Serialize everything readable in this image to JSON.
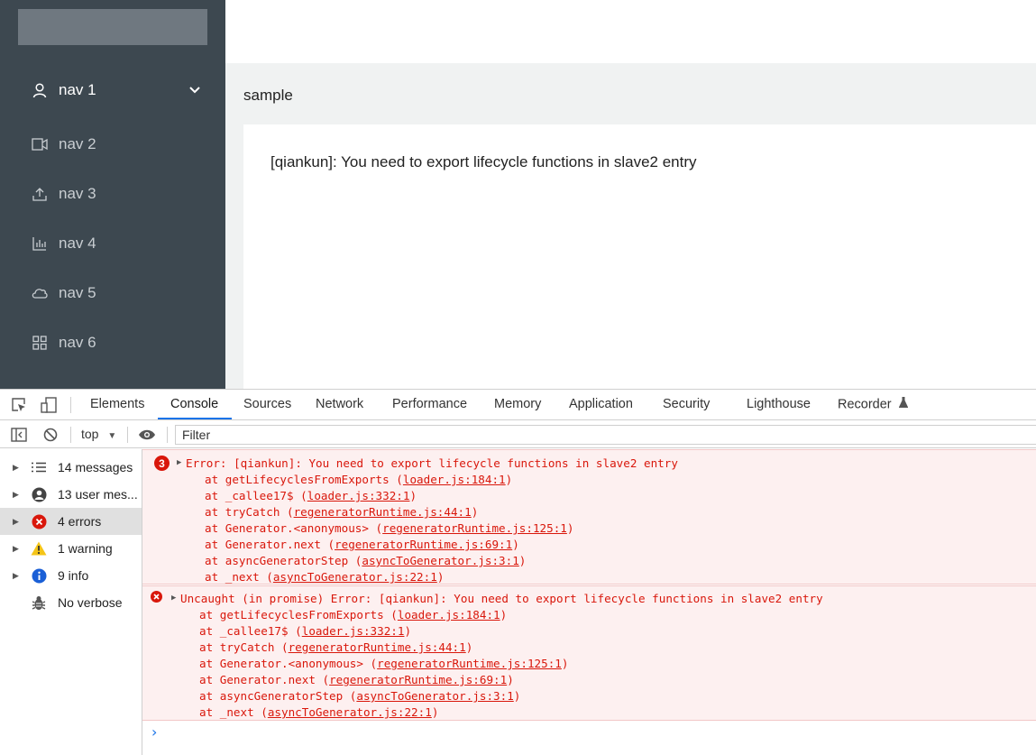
{
  "app": {
    "nav": [
      {
        "label": "nav 1",
        "icon": "user-icon"
      },
      {
        "label": "nav 2",
        "icon": "video-camera-icon"
      },
      {
        "label": "nav 3",
        "icon": "upload-icon"
      },
      {
        "label": "nav 4",
        "icon": "bar-chart-icon"
      },
      {
        "label": "nav 5",
        "icon": "cloud-icon"
      },
      {
        "label": "nav 6",
        "icon": "appstore-icon"
      }
    ],
    "breadcrumb": "sample",
    "message": "[qiankun]: You need to export lifecycle functions in slave2 entry"
  },
  "devtools": {
    "tabs": [
      "Elements",
      "Console",
      "Sources",
      "Network",
      "Performance",
      "Memory",
      "Application",
      "Security",
      "Lighthouse",
      "Recorder"
    ],
    "active_tab": "Console",
    "context": "top",
    "filter_placeholder": "Filter",
    "sidebar": [
      {
        "label": "14 messages",
        "icon": "list-icon"
      },
      {
        "label": "13 user mes...",
        "icon": "user-circle-icon"
      },
      {
        "label": "4 errors",
        "icon": "error-icon"
      },
      {
        "label": "1 warning",
        "icon": "warning-icon"
      },
      {
        "label": "9 info",
        "icon": "info-icon"
      },
      {
        "label": "No verbose",
        "icon": "bug-icon"
      }
    ],
    "errors": [
      {
        "count": "3",
        "message": "Error: [qiankun]: You need to export lifecycle functions in slave2 entry",
        "frames": [
          {
            "prefix": "at getLifecyclesFromExports (",
            "link": "loader.js:184:1",
            "suffix": ")"
          },
          {
            "prefix": "at _callee17$ (",
            "link": "loader.js:332:1",
            "suffix": ")"
          },
          {
            "prefix": "at tryCatch (",
            "link": "regeneratorRuntime.js:44:1",
            "suffix": ")"
          },
          {
            "prefix": "at Generator.<anonymous> (",
            "link": "regeneratorRuntime.js:125:1",
            "suffix": ")"
          },
          {
            "prefix": "at Generator.next (",
            "link": "regeneratorRuntime.js:69:1",
            "suffix": ")"
          },
          {
            "prefix": "at asyncGeneratorStep (",
            "link": "asyncToGenerator.js:3:1",
            "suffix": ")"
          },
          {
            "prefix": "at _next (",
            "link": "asyncToGenerator.js:22:1",
            "suffix": ")"
          }
        ]
      },
      {
        "message": "Uncaught (in promise) Error: [qiankun]: You need to export lifecycle functions in slave2 entry",
        "frames": [
          {
            "prefix": "at getLifecyclesFromExports (",
            "link": "loader.js:184:1",
            "suffix": ")"
          },
          {
            "prefix": "at _callee17$ (",
            "link": "loader.js:332:1",
            "suffix": ")"
          },
          {
            "prefix": "at tryCatch (",
            "link": "regeneratorRuntime.js:44:1",
            "suffix": ")"
          },
          {
            "prefix": "at Generator.<anonymous> (",
            "link": "regeneratorRuntime.js:125:1",
            "suffix": ")"
          },
          {
            "prefix": "at Generator.next (",
            "link": "regeneratorRuntime.js:69:1",
            "suffix": ")"
          },
          {
            "prefix": "at asyncGeneratorStep (",
            "link": "asyncToGenerator.js:3:1",
            "suffix": ")"
          },
          {
            "prefix": "at _next (",
            "link": "asyncToGenerator.js:22:1",
            "suffix": ")"
          }
        ]
      }
    ],
    "prompt_symbol": "›",
    "colors": {
      "error": "#d9170b",
      "accent": "#1a73e8",
      "warning": "#f5c518",
      "info": "#1a5fd6",
      "sidebar_bg": "#3d4850"
    }
  }
}
